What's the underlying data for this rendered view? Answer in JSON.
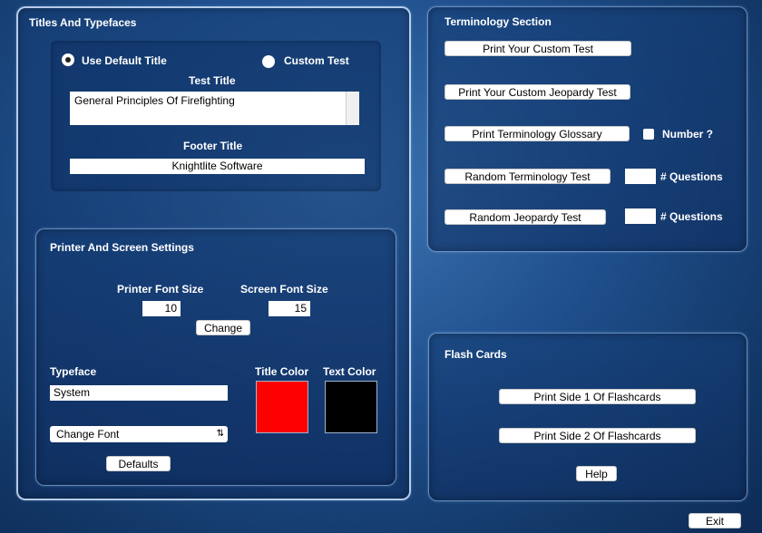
{
  "titles": {
    "heading": "Titles And Typefaces",
    "radio_default": "Use Default Title",
    "radio_custom": "Custom Test",
    "test_title_label": "Test Title",
    "test_title_value": "General Principles Of Firefighting",
    "footer_title_label": "Footer Title",
    "footer_title_value": "Knightlite Software"
  },
  "printer": {
    "heading": "Printer And Screen Settings",
    "printer_font_label": "Printer Font Size",
    "printer_font_value": "10",
    "screen_font_label": "Screen Font Size",
    "screen_font_value": "15",
    "change_label": "Change",
    "typeface_label": "Typeface",
    "typeface_value": "System",
    "change_font_label": "Change Font",
    "title_color_label": "Title Color",
    "text_color_label": "Text  Color",
    "title_color": "#ff0000",
    "text_color": "#000000",
    "defaults_label": "Defaults"
  },
  "terminology": {
    "heading": "Terminology Section",
    "print_custom_test": "Print Your Custom Test",
    "print_custom_jeopardy": "Print Your Custom Jeopardy Test",
    "print_glossary": "Print Terminology Glossary",
    "number_label": "Number ?",
    "random_term_test": "Random Terminology Test",
    "random_jeopardy_test": "Random Jeopardy Test",
    "questions_label": "# Questions",
    "term_questions_value": "",
    "jeopardy_questions_value": ""
  },
  "flash": {
    "heading": "Flash Cards",
    "print_side1": "Print Side 1 Of Flashcards",
    "print_side2": "Print Side 2 Of Flashcards",
    "help": "Help"
  },
  "exit_label": "Exit"
}
